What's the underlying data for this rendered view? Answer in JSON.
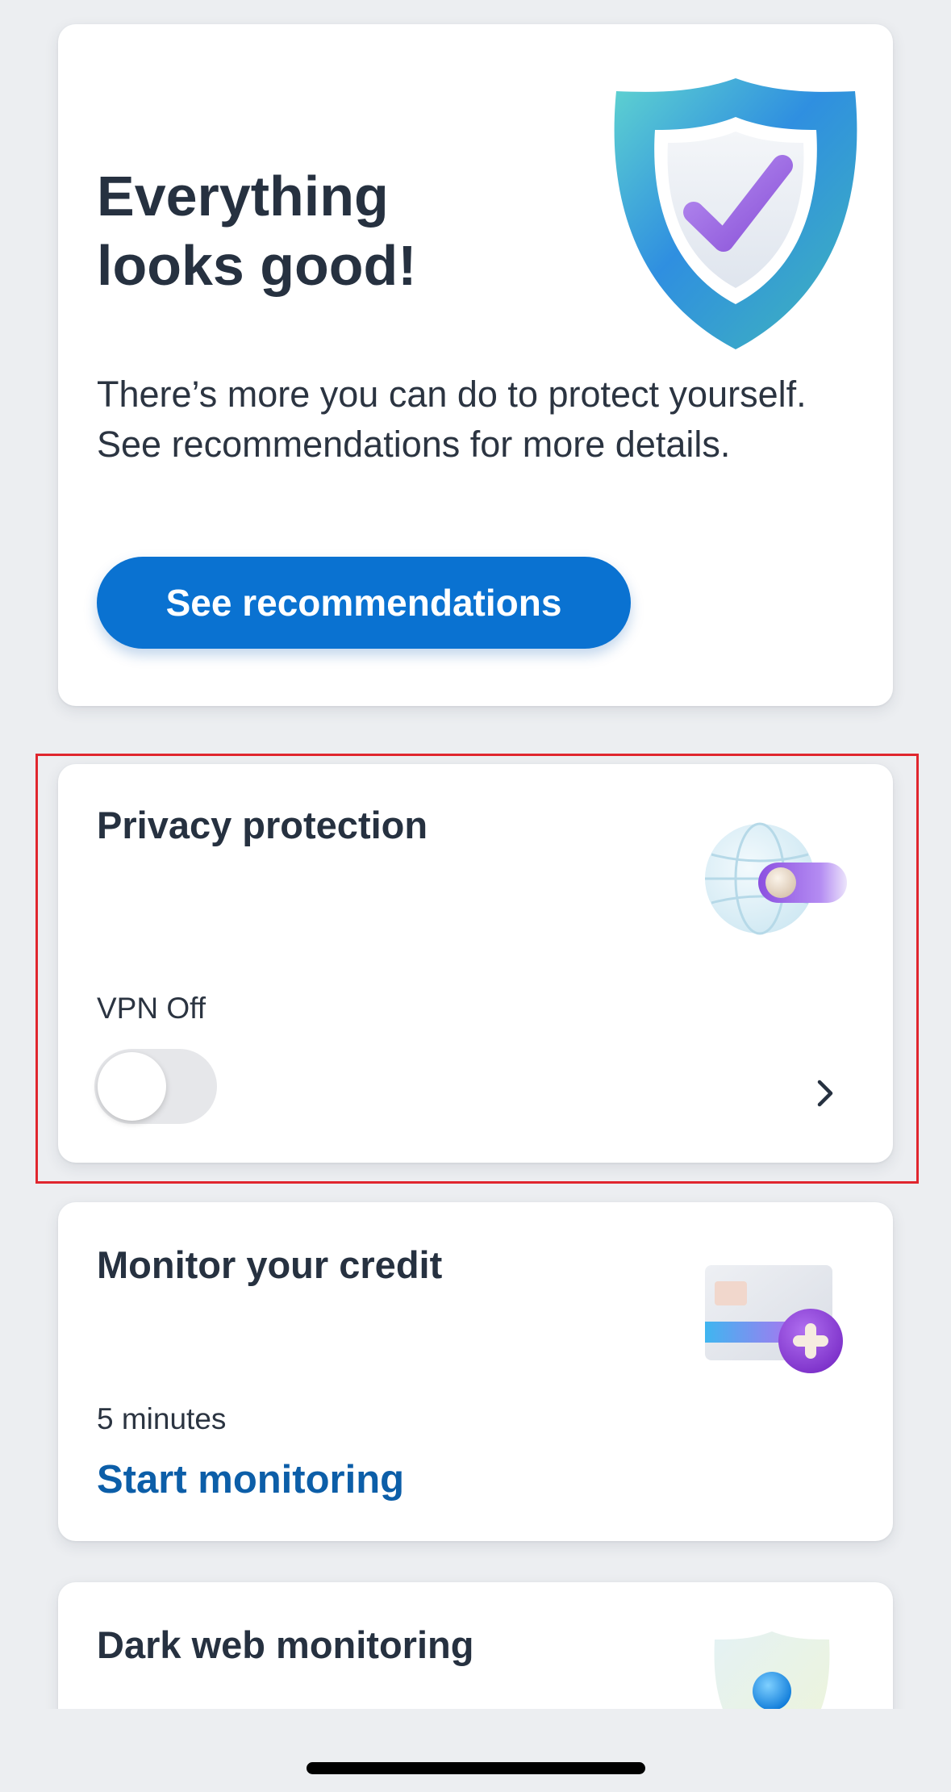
{
  "status_card": {
    "title": "Everything looks good!",
    "description": "There’s more you can do to protect yourself. See recommendations for more details.",
    "button_label": "See recommendations"
  },
  "privacy_card": {
    "title": "Privacy protection",
    "vpn_status": "VPN Off",
    "vpn_enabled": false,
    "icon": "globe-toggle-icon"
  },
  "credit_card": {
    "title": "Monitor your credit",
    "time_estimate": "5 minutes",
    "action_label": "Start monitoring",
    "icon": "credit-card-plus-icon"
  },
  "darkweb_card": {
    "title": "Dark web monitoring",
    "icon": "person-shield-icon"
  },
  "colors": {
    "accent": "#0a72d1",
    "link": "#0c5ea8",
    "highlight": "#e0262e",
    "background": "#eceef1"
  }
}
